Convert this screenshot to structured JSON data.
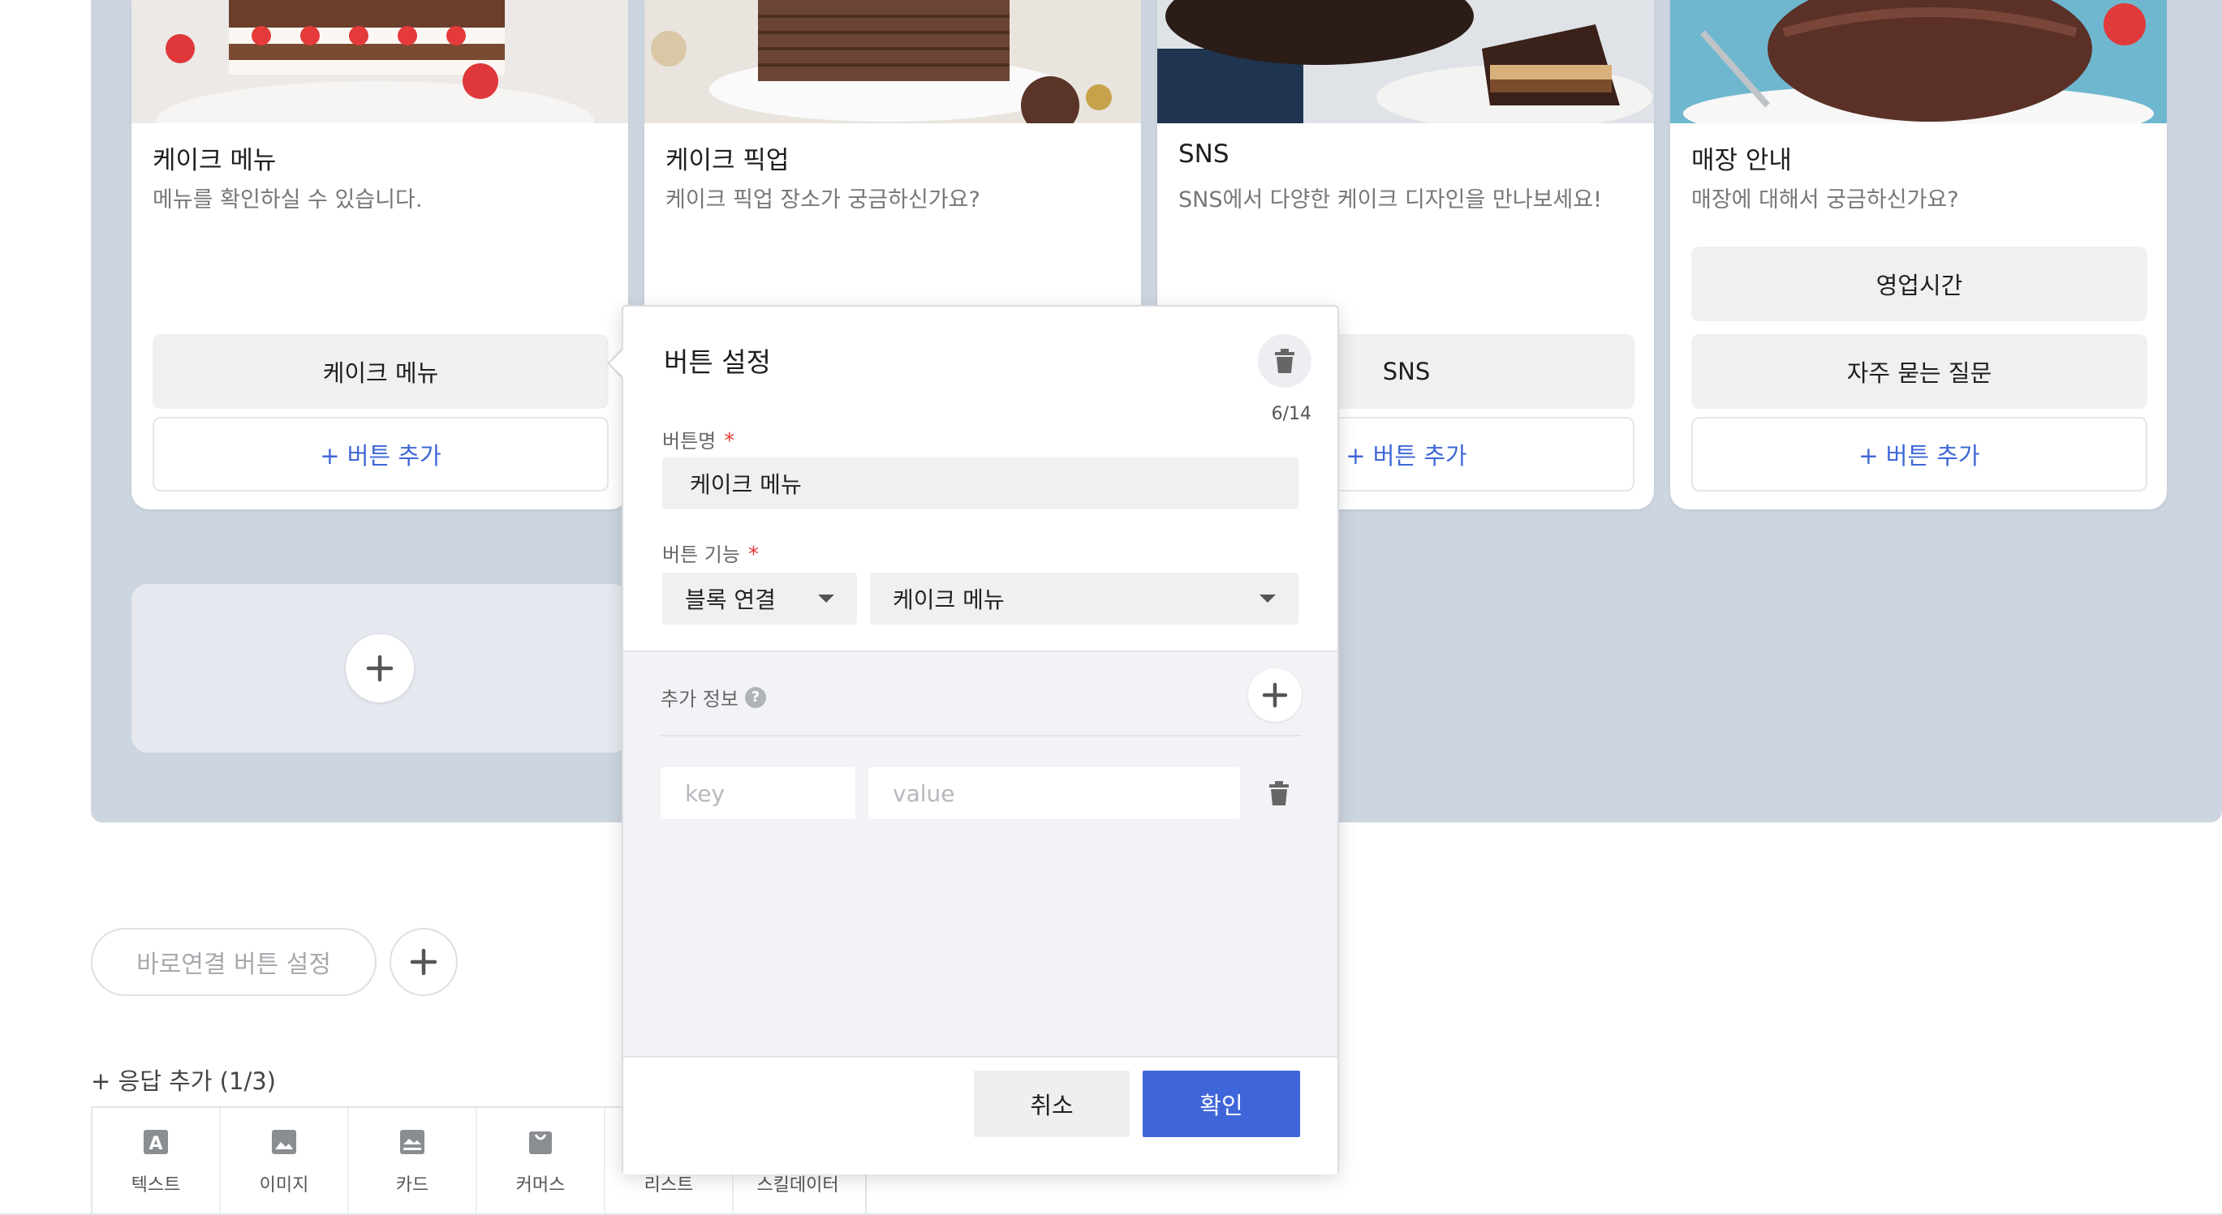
{
  "cards": [
    {
      "title": "케이크 메뉴",
      "description": "메뉴를 확인하실 수 있습니다.",
      "buttons": [
        "케이크 메뉴"
      ],
      "add_button": "+ 버튼 추가",
      "image": "strawberry-layer-cake-image"
    },
    {
      "title": "케이크 픽업",
      "description": "케이크 픽업 장소가 궁금하신가요?",
      "buttons": [],
      "add_button": "",
      "image": "chocolate-crepe-cake-image"
    },
    {
      "title": "SNS",
      "description": "SNS에서 다양한 케이크 디자인을 만나보세요!",
      "buttons": [
        "SNS"
      ],
      "add_button": "+ 버튼 추가",
      "image": "chocolate-mousse-cake-image"
    },
    {
      "title": "매장 안내",
      "description": "매장에 대해서 궁금하신가요?",
      "buttons": [
        "영업시간",
        "자주 묻는 질문"
      ],
      "add_button": "+ 버튼 추가",
      "image": "chocolate-bundt-cake-image"
    }
  ],
  "quick_reply": {
    "label": "바로연결 버튼 설정"
  },
  "response": {
    "add_label": "+ 응답 추가 (1/3)",
    "types": [
      {
        "label": "텍스트",
        "icon": "text-icon"
      },
      {
        "label": "이미지",
        "icon": "image-icon"
      },
      {
        "label": "카드",
        "icon": "card-icon"
      },
      {
        "label": "커머스",
        "icon": "commerce-icon"
      },
      {
        "label": "리스트",
        "icon": "list-icon"
      },
      {
        "label": "스킬데이터",
        "icon": "skill-data-icon"
      }
    ]
  },
  "popover": {
    "title": "버튼 설정",
    "counter": "6/14",
    "name_label": "버튼명",
    "required_mark": "*",
    "name_value": "케이크 메뉴",
    "function_label": "버튼 기능",
    "function_type": "블록 연결",
    "function_target": "케이크 메뉴",
    "extra_label": "추가 정보",
    "help_glyph": "?",
    "key_placeholder": "key",
    "value_placeholder": "value",
    "cancel_label": "취소",
    "confirm_label": "확인"
  },
  "colors": {
    "carousel_bg": "#cdd6e0",
    "accent": "#3f66d9",
    "link": "#3e67d6",
    "required": "#e53935"
  }
}
